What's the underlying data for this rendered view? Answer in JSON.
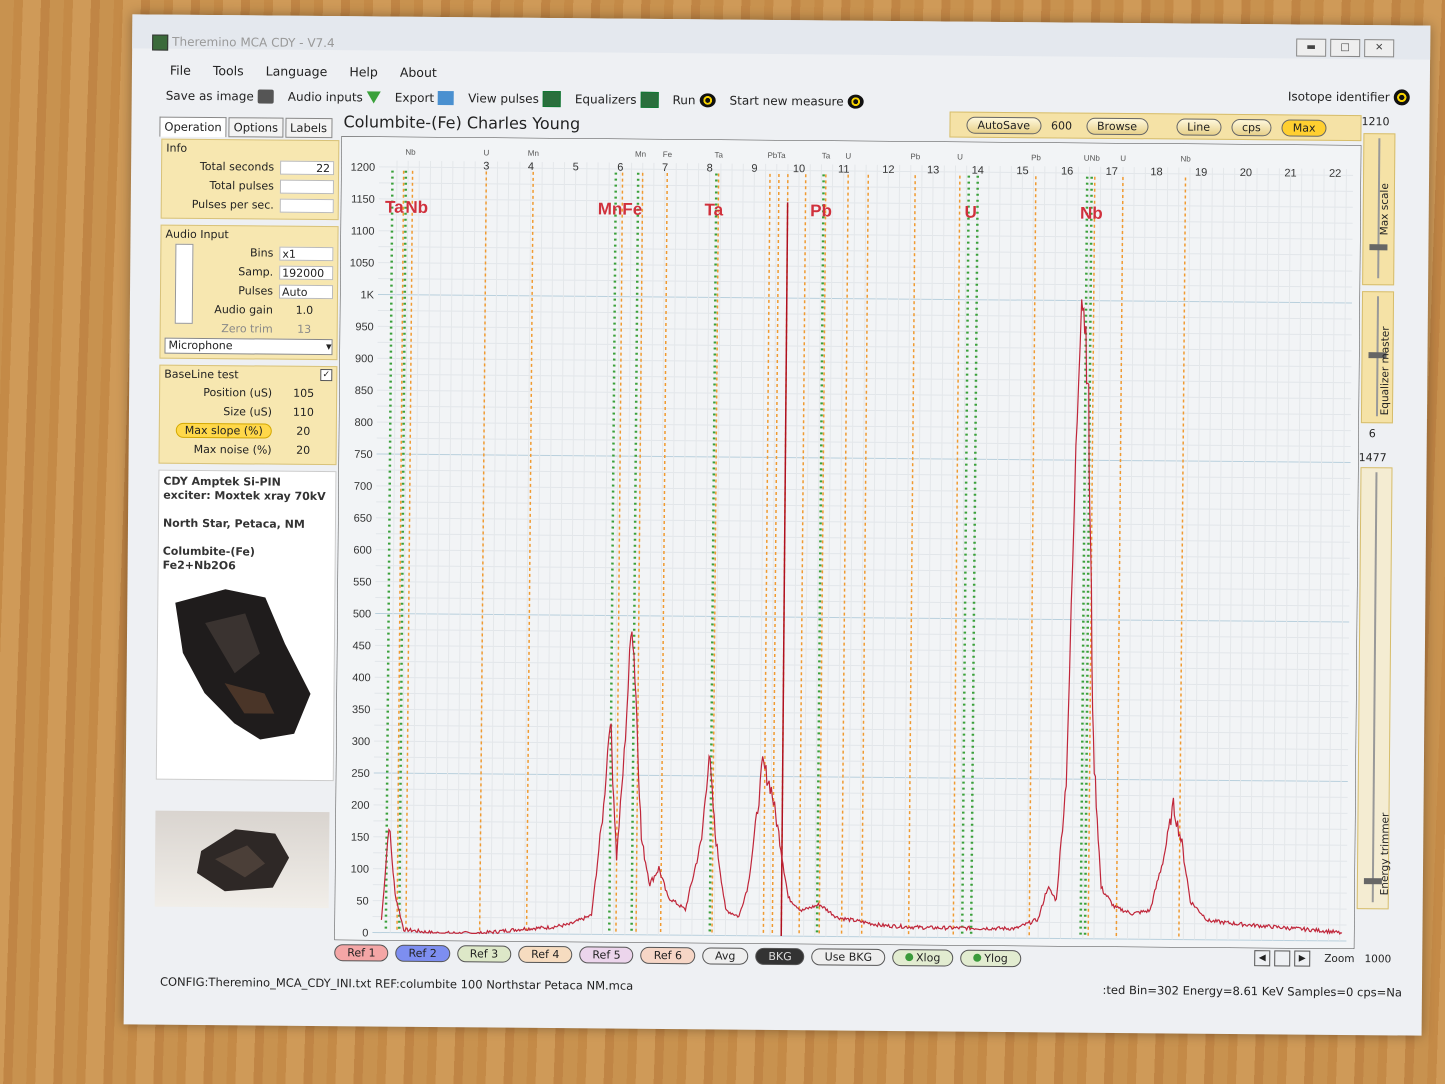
{
  "window": {
    "title": "Theremino MCA CDY - V7.4"
  },
  "menu": [
    "File",
    "Tools",
    "Language",
    "Help",
    "About"
  ],
  "toolbar": {
    "save_image": "Save as image",
    "audio_inputs": "Audio inputs",
    "export": "Export",
    "view_pulses": "View pulses",
    "equalizers": "Equalizers",
    "run": "Run",
    "start_new": "Start new measure",
    "isotope": "Isotope identifier"
  },
  "tabs": [
    "Operation",
    "Options",
    "Labels"
  ],
  "info": {
    "title": "Info",
    "total_seconds_label": "Total seconds",
    "total_seconds": "22",
    "total_pulses_label": "Total pulses",
    "total_pulses": "",
    "pps_label": "Pulses per sec.",
    "pps": ""
  },
  "audio": {
    "title": "Audio Input",
    "bins_label": "Bins",
    "bins": "x1",
    "samp_label": "Samp.",
    "samp": "192000",
    "pulses_label": "Pulses",
    "pulses": "Auto",
    "gain_label": "Audio gain",
    "gain": "1.0",
    "zero_label": "Zero trim",
    "zero": "13",
    "device": "Microphone"
  },
  "baseline": {
    "title": "BaseLine test",
    "position_label": "Position (uS)",
    "position": "105",
    "size_label": "Size (uS)",
    "size": "110",
    "maxslope_label": "Max slope (%)",
    "maxslope": "20",
    "maxnoise_label": "Max noise (%)",
    "maxnoise": "20"
  },
  "notes": [
    "CDY Amptek Si-PIN",
    "exciter: Moxtek xray 70kV",
    "",
    "North Star, Petaca, NM",
    "",
    "Columbite-(Fe)",
    "Fe2+Nb2O6"
  ],
  "chart_title": "Columbite-(Fe) Charles Young",
  "topctrls": {
    "autosave": "AutoSave",
    "value": "600",
    "browse": "Browse",
    "line": "Line",
    "cps": "cps",
    "max": "Max"
  },
  "right": {
    "top_value": "1210",
    "max_scale": "Max scale",
    "eq_master": "Equalizer master",
    "eq_value": "6",
    "trim_value": "1477",
    "energy_trimmer": "Energy trimmer",
    "zoom_label": "Zoom",
    "zoom_value": "1000"
  },
  "bottom": {
    "refs": [
      "Ref 1",
      "Ref 2",
      "Ref 3",
      "Ref 4",
      "Ref 5",
      "Ref 6"
    ],
    "avg": "Avg",
    "bkg": "BKG",
    "use_bkg": "Use BKG",
    "xlog": "Xlog",
    "ylog": "Ylog"
  },
  "ref_colors": [
    "#f4a6a6",
    "#7d8ef0",
    "#dde8c8",
    "#f6dcc0",
    "#ecd5ec",
    "#f6d6c6"
  ],
  "status": {
    "config": "CONFIG:Theremino_MCA_CDY_INI.txt REF:columbite 100 Northstar Petaca NM.mca",
    "right": ":ted Bin=302  Energy=8.61 KeV  Samples=0  cps=Na"
  },
  "chart_data": {
    "type": "line",
    "x_unit": "keV",
    "xlim": [
      0.6,
      22.4
    ],
    "ylim": [
      0,
      1210
    ],
    "xticks": [
      3,
      4,
      5,
      6,
      7,
      8,
      9,
      10,
      11,
      12,
      13,
      14,
      15,
      16,
      17,
      18,
      19,
      20,
      21,
      22
    ],
    "yticks": [
      {
        "v": 0,
        "t": "0"
      },
      {
        "v": 50,
        "t": "50"
      },
      {
        "v": 100,
        "t": "100"
      },
      {
        "v": 150,
        "t": "150"
      },
      {
        "v": 200,
        "t": "200"
      },
      {
        "v": 250,
        "t": "250"
      },
      {
        "v": 300,
        "t": "300"
      },
      {
        "v": 350,
        "t": "350"
      },
      {
        "v": 400,
        "t": "400"
      },
      {
        "v": 450,
        "t": "450"
      },
      {
        "v": 500,
        "t": "500"
      },
      {
        "v": 550,
        "t": "550"
      },
      {
        "v": 600,
        "t": "600"
      },
      {
        "v": 650,
        "t": "650"
      },
      {
        "v": 700,
        "t": "700"
      },
      {
        "v": 750,
        "t": "750"
      },
      {
        "v": 800,
        "t": "800"
      },
      {
        "v": 850,
        "t": "850"
      },
      {
        "v": 900,
        "t": "900"
      },
      {
        "v": 950,
        "t": "950"
      },
      {
        "v": 1000,
        "t": "1K"
      },
      {
        "v": 1050,
        "t": "1050"
      },
      {
        "v": 1100,
        "t": "1100"
      },
      {
        "v": 1150,
        "t": "1150"
      },
      {
        "v": 1200,
        "t": "1200"
      }
    ],
    "grid": true,
    "series": [
      {
        "color": "#c0263a",
        "points": [
          [
            0.8,
            20
          ],
          [
            0.95,
            170
          ],
          [
            1.1,
            60
          ],
          [
            1.3,
            5
          ],
          [
            2,
            0
          ],
          [
            3,
            0
          ],
          [
            3.5,
            4
          ],
          [
            4,
            8
          ],
          [
            4.5,
            10
          ],
          [
            5,
            15
          ],
          [
            5.5,
            30
          ],
          [
            5.75,
            200
          ],
          [
            5.88,
            345
          ],
          [
            5.95,
            250
          ],
          [
            6.05,
            120
          ],
          [
            6.2,
            280
          ],
          [
            6.35,
            500
          ],
          [
            6.45,
            380
          ],
          [
            6.6,
            150
          ],
          [
            6.8,
            80
          ],
          [
            7.0,
            105
          ],
          [
            7.2,
            60
          ],
          [
            7.6,
            40
          ],
          [
            7.95,
            150
          ],
          [
            8.1,
            285
          ],
          [
            8.25,
            160
          ],
          [
            8.5,
            40
          ],
          [
            8.8,
            30
          ],
          [
            9.0,
            80
          ],
          [
            9.2,
            200
          ],
          [
            9.3,
            270
          ],
          [
            9.5,
            230
          ],
          [
            9.7,
            150
          ],
          [
            9.9,
            60
          ],
          [
            10.2,
            40
          ],
          [
            10.6,
            50
          ],
          [
            11.0,
            30
          ],
          [
            12,
            18
          ],
          [
            13,
            15
          ],
          [
            14,
            15
          ],
          [
            15,
            15
          ],
          [
            15.5,
            30
          ],
          [
            15.7,
            80
          ],
          [
            15.9,
            60
          ],
          [
            16.1,
            250
          ],
          [
            16.25,
            750
          ],
          [
            16.35,
            1050
          ],
          [
            16.5,
            900
          ],
          [
            16.7,
            300
          ],
          [
            16.9,
            80
          ],
          [
            17.2,
            50
          ],
          [
            17.6,
            40
          ],
          [
            18.0,
            45
          ],
          [
            18.3,
            130
          ],
          [
            18.5,
            210
          ],
          [
            18.7,
            150
          ],
          [
            18.9,
            60
          ],
          [
            19.3,
            30
          ],
          [
            20,
            25
          ],
          [
            21,
            20
          ],
          [
            22,
            15
          ],
          [
            22.3,
            12
          ]
        ]
      }
    ],
    "markers": [
      {
        "x": 9.75,
        "height": 1150,
        "color": "#b01020"
      }
    ],
    "lines": [
      {
        "x": 0.9,
        "c": "g"
      },
      {
        "x": 1.15,
        "c": "o"
      },
      {
        "x": 1.2,
        "c": "g"
      },
      {
        "x": 1.35,
        "c": "o"
      },
      {
        "x": 3.0,
        "c": "o"
      },
      {
        "x": 4.05,
        "c": "o"
      },
      {
        "x": 5.9,
        "c": "g"
      },
      {
        "x": 6.05,
        "c": "o"
      },
      {
        "x": 6.4,
        "c": "g"
      },
      {
        "x": 6.5,
        "c": "o"
      },
      {
        "x": 7.05,
        "c": "o"
      },
      {
        "x": 8.15,
        "c": "g"
      },
      {
        "x": 8.2,
        "c": "o"
      },
      {
        "x": 9.35,
        "c": "o"
      },
      {
        "x": 9.55,
        "c": "o"
      },
      {
        "x": 9.75,
        "c": "o"
      },
      {
        "x": 10.15,
        "c": "o"
      },
      {
        "x": 10.55,
        "c": "g"
      },
      {
        "x": 10.6,
        "c": "o"
      },
      {
        "x": 11.1,
        "c": "o"
      },
      {
        "x": 11.55,
        "c": "o"
      },
      {
        "x": 12.6,
        "c": "o"
      },
      {
        "x": 13.6,
        "c": "o"
      },
      {
        "x": 13.8,
        "c": "g"
      },
      {
        "x": 14.0,
        "c": "g"
      },
      {
        "x": 15.3,
        "c": "o"
      },
      {
        "x": 16.45,
        "c": "g"
      },
      {
        "x": 16.55,
        "c": "g"
      },
      {
        "x": 16.62,
        "c": "o"
      },
      {
        "x": 17.25,
        "c": "o"
      },
      {
        "x": 18.65,
        "c": "o"
      }
    ],
    "line_labels": [
      {
        "x": 1.3,
        "t": "Nb"
      },
      {
        "x": 3.0,
        "t": "U"
      },
      {
        "x": 4.05,
        "t": "Mn"
      },
      {
        "x": 6.45,
        "t": "Mn"
      },
      {
        "x": 7.05,
        "t": "Fe"
      },
      {
        "x": 8.2,
        "t": "Ta"
      },
      {
        "x": 9.4,
        "t": "Pb"
      },
      {
        "x": 9.6,
        "t": "Ta"
      },
      {
        "x": 10.6,
        "t": "Ta"
      },
      {
        "x": 11.1,
        "t": "U"
      },
      {
        "x": 12.6,
        "t": "Pb"
      },
      {
        "x": 13.6,
        "t": "U"
      },
      {
        "x": 15.3,
        "t": "Pb"
      },
      {
        "x": 16.55,
        "t": "UNb"
      },
      {
        "x": 17.25,
        "t": "U"
      },
      {
        "x": 18.65,
        "t": "Nb"
      }
    ],
    "element_labels": [
      {
        "x": 0.95,
        "t": "Ta"
      },
      {
        "x": 1.45,
        "t": "Nb"
      },
      {
        "x": 6.0,
        "t": "MnFe"
      },
      {
        "x": 8.1,
        "t": "Ta"
      },
      {
        "x": 10.5,
        "t": "Pb"
      },
      {
        "x": 13.85,
        "t": "U"
      },
      {
        "x": 16.55,
        "t": "Nb"
      }
    ]
  }
}
